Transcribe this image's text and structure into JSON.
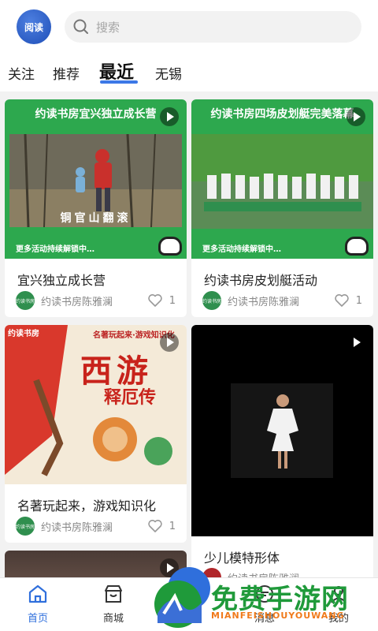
{
  "header": {
    "logo_text": "阅读",
    "search_placeholder": "搜索"
  },
  "tabs": [
    {
      "label": "关注"
    },
    {
      "label": "推荐"
    },
    {
      "label": "最近"
    },
    {
      "label": "无锡"
    }
  ],
  "cards": [
    {
      "title": "宜兴独立成长营",
      "author": "约读书房陈雅澜",
      "likes": "1",
      "poster_head": "约读书房宜兴独立成长营",
      "poster_caption": "铜官山翻滚",
      "poster_foot": "更多活动持续解锁中…"
    },
    {
      "title": "约读书房皮划艇活动",
      "author": "约读书房陈雅澜",
      "likes": "1",
      "poster_head": "约读书房四场皮划艇完美落幕",
      "poster_foot": "更多活动持续解锁中…"
    },
    {
      "title": "名著玩起来，游戏知识化",
      "author": "约读书房陈雅澜",
      "likes": "1",
      "poster_tag": "名著玩起来·游戏知识化",
      "poster_title": "西游",
      "poster_subtitle": "释厄传",
      "poster_brand": "约读书房"
    },
    {
      "title": "少儿模特形体",
      "author": "约读书房陈雅澜"
    }
  ],
  "avatar_text": "约读书房",
  "nav": [
    {
      "label": "首页"
    },
    {
      "label": "商城"
    },
    {
      "label": "消息"
    },
    {
      "label": "我的"
    }
  ],
  "watermark": {
    "text": "免费手游网",
    "sub": "MIANFEISHOUYOUWANG"
  },
  "colors": {
    "accent": "#2f6fdc",
    "poster_green": "#2da84e",
    "watermark_green": "#1f9a3a",
    "watermark_orange": "#f07a1a"
  }
}
